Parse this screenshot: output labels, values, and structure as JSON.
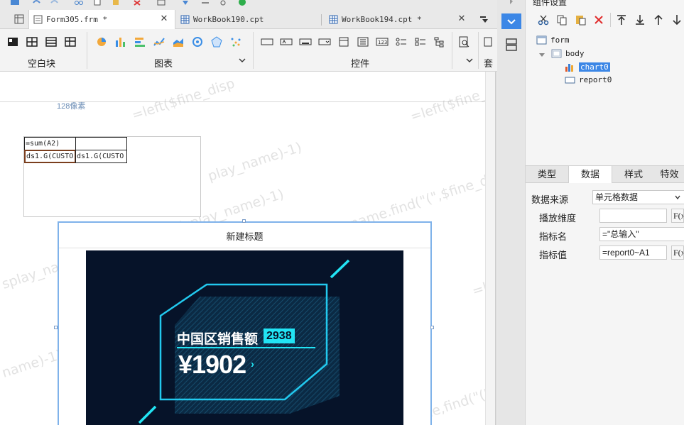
{
  "tabs": [
    {
      "label": "Form305.frm *",
      "icon": "form-file-icon",
      "active": true
    },
    {
      "label": "WorkBook190.cpt",
      "icon": "workbook-file-icon",
      "active": false
    },
    {
      "label": "WorkBook194.cpt *",
      "icon": "workbook-file-icon",
      "active": false
    }
  ],
  "ribbon": {
    "groups": [
      {
        "label": "空白块"
      },
      {
        "label": "图表"
      },
      {
        "label": "控件"
      },
      {
        "label": "套用"
      }
    ]
  },
  "canvas": {
    "ruler_text": "128像素",
    "watermark_fragments": [
      "=left($fine_disp",
      "=left($fine_d",
      "play_name)-1)",
      "splay_name,find(\"(\",$fine_display_name)-1)",
      "name.find(\"(\",$fine_display",
      "=le",
      "name)-1)",
      "name,find(\"(\",$fir"
    ],
    "cells": [
      {
        "text": "=sum(A2)"
      },
      {
        "text": ""
      },
      {
        "text": "ds1.G(CUSTO"
      },
      {
        "text": "ds1.G(CUSTO"
      }
    ],
    "chart": {
      "title": "新建标题",
      "kpi_label": "中国区销售额",
      "kpi_badge": "2938",
      "kpi_value": "¥1902",
      "kpi_arrow": "›"
    }
  },
  "component_panel": {
    "title": "组件设置",
    "tree": [
      {
        "label": "form",
        "icon": "form-node-icon"
      },
      {
        "label": "body",
        "icon": "body-node-icon"
      },
      {
        "label": "chart0",
        "icon": "chart-node-icon",
        "selected": true
      },
      {
        "label": "report0",
        "icon": "report-node-icon"
      }
    ]
  },
  "property_tabs": [
    {
      "label": "类型",
      "active": false
    },
    {
      "label": "数据",
      "active": true
    },
    {
      "label": "样式",
      "active": false
    },
    {
      "label": "特效",
      "active": false
    }
  ],
  "properties": {
    "source_label": "数据来源",
    "source_value": "单元格数据",
    "dimension_label": "播放维度",
    "dimension_value": "",
    "metric_name_label": "指标名",
    "metric_name_value": "=\"总输入\"",
    "metric_value_label": "指标值",
    "metric_value_value": "=report0~A1",
    "fx_label": "F(x)"
  },
  "colors": {
    "accent": "#3c87e6",
    "chart_bg": "#061329",
    "chart_cyan": "#22e4f4",
    "selection_frame": "#7fb2ea"
  }
}
